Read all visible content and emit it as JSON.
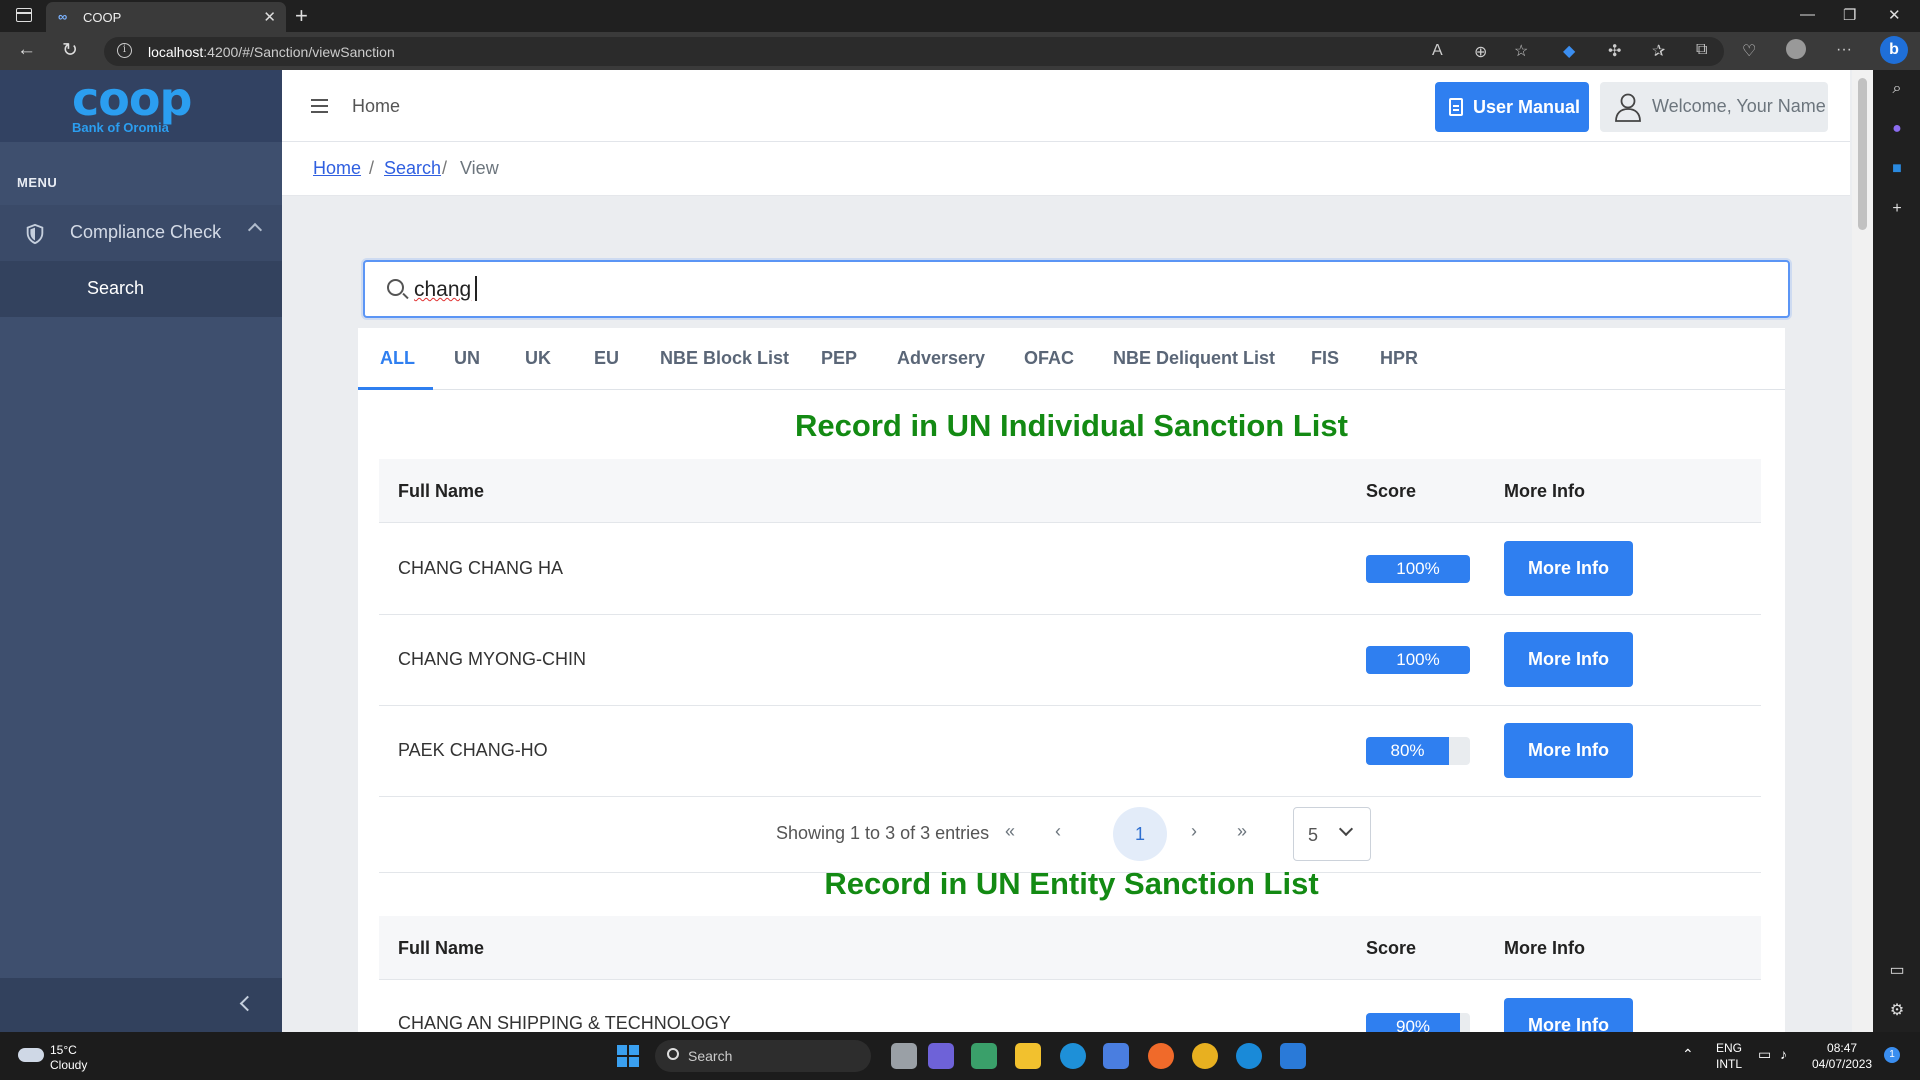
{
  "browser": {
    "tab_title": "COOP",
    "url_host": "localhost",
    "url_rest": ":4200/#/Sanction/viewSanction"
  },
  "sidebar": {
    "logo": "coop",
    "logo_sub": "Bank of Oromia",
    "menu_label": "MENU",
    "items": [
      {
        "label": "Compliance Check"
      },
      {
        "label": "Search"
      }
    ]
  },
  "topbar": {
    "home": "Home",
    "manual_label": "User Manual",
    "welcome": "Welcome, Your Name"
  },
  "breadcrumb": {
    "home": "Home",
    "search": "Search",
    "current": "View",
    "sep": "/"
  },
  "search": {
    "value": "chang"
  },
  "tabs": [
    "ALL",
    "UN",
    "UK",
    "EU",
    "NBE Block List",
    "PEP",
    "Adversery",
    "OFAC",
    "NBE Deliquent List",
    "FIS",
    "HPR"
  ],
  "active_tab": "ALL",
  "sections": [
    {
      "title": "Record in UN Individual Sanction List",
      "columns": [
        "Full Name",
        "Score",
        "More Info"
      ],
      "rows": [
        {
          "name": "CHANG CHANG HA",
          "score": "100%",
          "score_value": 100,
          "action": "More Info"
        },
        {
          "name": "CHANG MYONG-CHIN",
          "score": "100%",
          "score_value": 100,
          "action": "More Info"
        },
        {
          "name": "PAEK CHANG-HO",
          "score": "80%",
          "score_value": 80,
          "action": "More Info"
        }
      ],
      "pager": {
        "info": "Showing 1 to 3 of 3 entries",
        "current_page": "1",
        "page_size": "5"
      }
    },
    {
      "title": "Record in UN Entity Sanction List",
      "columns": [
        "Full Name",
        "Score",
        "More Info"
      ],
      "rows": [
        {
          "name": "CHANG AN SHIPPING & TECHNOLOGY",
          "score": "90%",
          "score_value": 90,
          "action": "More Info"
        }
      ]
    }
  ],
  "taskbar": {
    "weather_temp": "15°C",
    "weather_desc": "Cloudy",
    "search": "Search",
    "lang1": "ENG",
    "lang2": "INTL",
    "time": "08:47",
    "date": "04/07/2023",
    "notif": "1"
  }
}
